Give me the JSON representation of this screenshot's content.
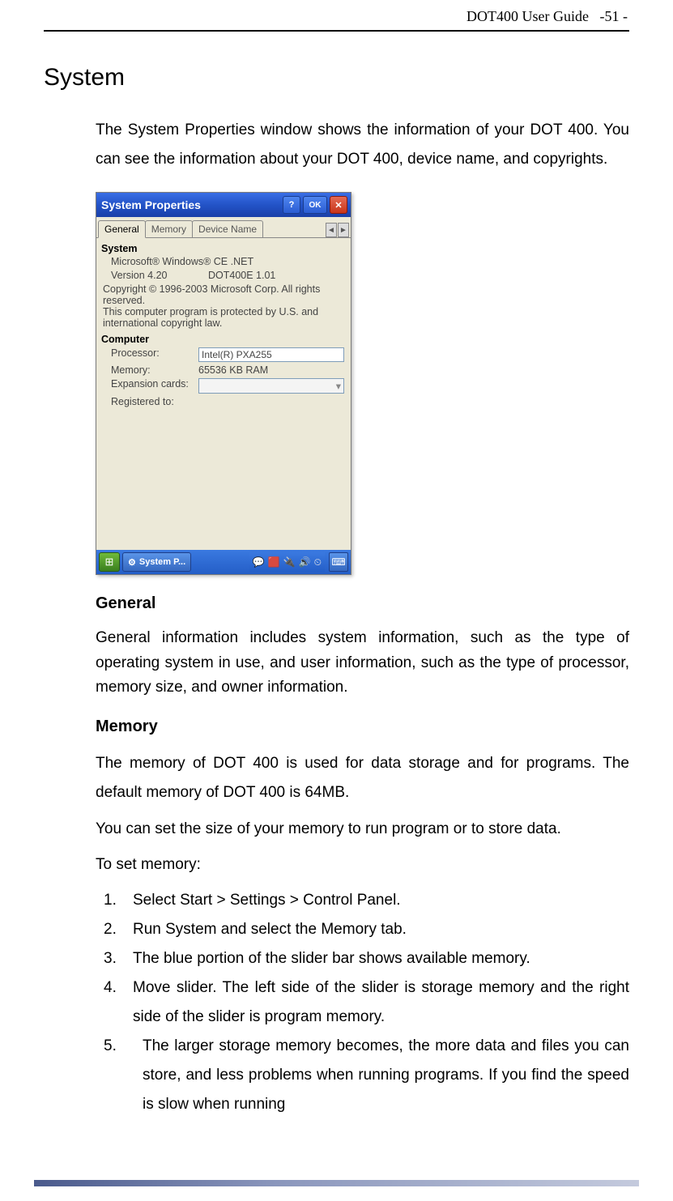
{
  "header": {
    "doc_title": "DOT400 User Guide",
    "page_num": "-51 -"
  },
  "h1": "System",
  "intro": "The System Properties window shows the information of your DOT 400. You can see the information about your DOT 400, device name, and copyrights.",
  "screenshot": {
    "title": "System Properties",
    "ok": "OK",
    "tabs": {
      "t1": "General",
      "t2": "Memory",
      "t3": "Device Name",
      "left": "◄",
      "right": "►"
    },
    "sys_header": "System",
    "os": "Microsoft® Windows® CE .NET",
    "ver_lbl": "Version 4.20",
    "ver_val": "DOT400E 1.01",
    "copy1": "Copyright © 1996-2003 Microsoft Corp. All rights reserved.",
    "copy2": "This computer program is protected by U.S. and international copyright law.",
    "comp_header": "Computer",
    "proc_lbl": "Processor:",
    "proc_val": "Intel(R) PXA255",
    "mem_lbl": "Memory:",
    "mem_val": "65536 KB  RAM",
    "exp_lbl": "Expansion cards:",
    "reg_lbl": "Registered to:",
    "taskbtn": "System P...",
    "start": "⊞"
  },
  "general": {
    "h": "General",
    "p": "General information includes system information, such as the type of operating system in use, and user information, such as the type of processor, memory size, and owner information."
  },
  "memory": {
    "h": "Memory",
    "p1": "The memory of DOT 400 is used for data storage and for programs. The default memory of DOT 400 is 64MB.",
    "p2": "You can set the size of your memory to run program or to store data.",
    "p3": "To set memory:",
    "steps": {
      "n1": "1.",
      "s1": "Select Start > Settings > Control Panel.",
      "n2": "2.",
      "s2": "Run System and select the Memory tab.",
      "n3": "3.",
      "s3": "The blue portion of the slider bar shows available memory.",
      "n4": "4.",
      "s4": "Move slider. The left side of the slider is storage memory and the right side of the slider is program memory.",
      "n5": "5.",
      "s5": "The larger storage memory becomes, the more data and files you can store, and less problems when running programs. If you find the speed is slow when running"
    }
  }
}
